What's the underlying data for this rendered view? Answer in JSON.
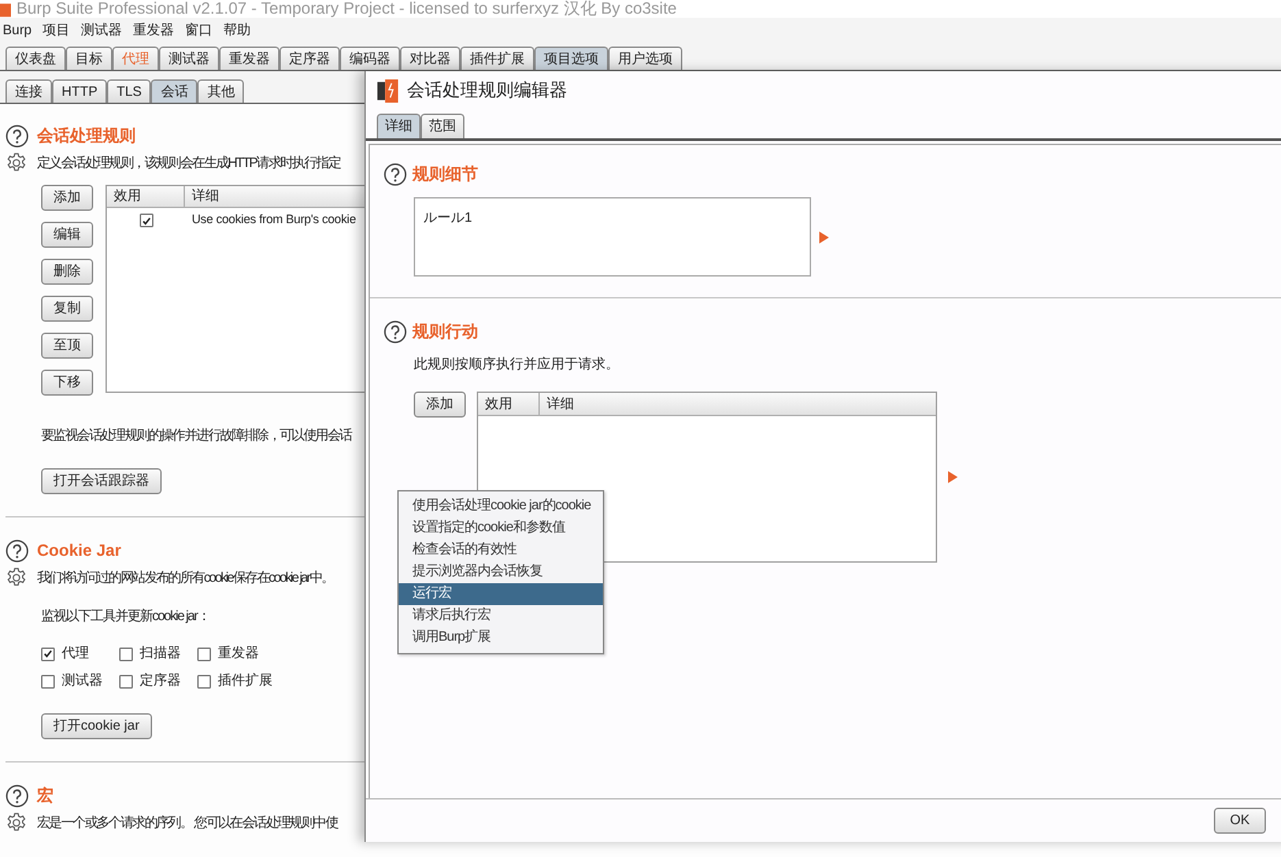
{
  "window": {
    "title": "Burp Suite Professional v2.1.07 - Temporary Project - licensed to surferxyz 汉化 By co3site"
  },
  "menu_bar": [
    "Burp",
    "项目",
    "测试器",
    "重发器",
    "窗口",
    "帮助"
  ],
  "main_tabs": [
    {
      "label": "仪表盘",
      "selected": false,
      "highlighted": false
    },
    {
      "label": "目标",
      "selected": false,
      "highlighted": false
    },
    {
      "label": "代理",
      "selected": false,
      "highlighted": true
    },
    {
      "label": "测试器",
      "selected": false,
      "highlighted": false
    },
    {
      "label": "重发器",
      "selected": false,
      "highlighted": false
    },
    {
      "label": "定序器",
      "selected": false,
      "highlighted": false
    },
    {
      "label": "编码器",
      "selected": false,
      "highlighted": false
    },
    {
      "label": "对比器",
      "selected": false,
      "highlighted": false
    },
    {
      "label": "插件扩展",
      "selected": false,
      "highlighted": false
    },
    {
      "label": "项目选项",
      "selected": true,
      "highlighted": false
    },
    {
      "label": "用户选项",
      "selected": false,
      "highlighted": false
    }
  ],
  "sub_tabs": [
    {
      "label": "连接",
      "selected": false
    },
    {
      "label": "HTTP",
      "selected": false
    },
    {
      "label": "TLS",
      "selected": false
    },
    {
      "label": "会话",
      "selected": true
    },
    {
      "label": "其他",
      "selected": false
    }
  ],
  "session_rules": {
    "title": "会话处理规则",
    "description": "定义会话处理规则，该规则会在生成HTTP请求时执行指定",
    "buttons": [
      "添加",
      "编辑",
      "删除",
      "复制",
      "至顶",
      "下移"
    ],
    "columns": [
      "效用",
      "详细"
    ],
    "rows": [
      {
        "enabled": true,
        "detail": "Use cookies from Burp's cookie"
      }
    ],
    "note": "要监视会话处理规则的操作并进行故障排除，可以使用会话",
    "tracer_button": "打开会话跟踪器"
  },
  "cookie_jar": {
    "title": "Cookie Jar",
    "description": "我们将访问过的网站发布的所有cookie保存在cookie jar中。",
    "monitor_label": "监视以下工具并更新cookie jar：",
    "tools": [
      {
        "label": "代理",
        "checked": true
      },
      {
        "label": "扫描器",
        "checked": false
      },
      {
        "label": "重发器",
        "checked": false
      },
      {
        "label": "测试器",
        "checked": false
      },
      {
        "label": "定序器",
        "checked": false
      },
      {
        "label": "插件扩展",
        "checked": false
      }
    ],
    "open_button": "打开cookie jar"
  },
  "macros": {
    "title": "宏",
    "description": "宏是一个或多个请求的序列。 您可以在会话处理规则中使"
  },
  "dialog": {
    "title": "会话处理规则编辑器",
    "tabs": [
      {
        "label": "详细",
        "selected": true
      },
      {
        "label": "范围",
        "selected": false
      }
    ],
    "rule_details": {
      "title": "规则细节",
      "name": "ルール1"
    },
    "rule_actions": {
      "title": "规则行动",
      "description": "此规则按顺序执行并应用于请求。",
      "add_button": "添加",
      "columns": [
        "效用",
        "详细"
      ],
      "menu": [
        {
          "label": "使用会话处理cookie jar的cookie",
          "selected": false
        },
        {
          "label": "设置指定的cookie和参数值",
          "selected": false
        },
        {
          "label": "检查会话的有效性",
          "selected": false
        },
        {
          "label": "提示浏览器内会话恢复",
          "selected": false
        },
        {
          "label": "运行宏",
          "selected": true
        },
        {
          "label": "请求后执行宏",
          "selected": false
        },
        {
          "label": "调用Burp扩展",
          "selected": false
        }
      ]
    },
    "buttons": [
      "OK"
    ]
  }
}
